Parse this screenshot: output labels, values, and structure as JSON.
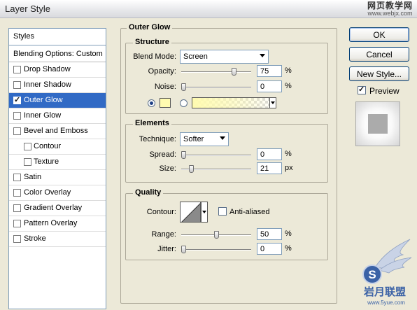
{
  "window": {
    "title": "Layer Style",
    "watermark_cn": "网页教学网",
    "watermark_url": "www.webjx.com"
  },
  "styles_list": {
    "header": "Styles",
    "blending_options": "Blending Options: Custom",
    "items": [
      {
        "label": "Drop Shadow",
        "checked": false,
        "sub": false,
        "selected": false
      },
      {
        "label": "Inner Shadow",
        "checked": false,
        "sub": false,
        "selected": false
      },
      {
        "label": "Outer Glow",
        "checked": true,
        "sub": false,
        "selected": true
      },
      {
        "label": "Inner Glow",
        "checked": false,
        "sub": false,
        "selected": false
      },
      {
        "label": "Bevel and Emboss",
        "checked": false,
        "sub": false,
        "selected": false
      },
      {
        "label": "Contour",
        "checked": false,
        "sub": true,
        "selected": false
      },
      {
        "label": "Texture",
        "checked": false,
        "sub": true,
        "selected": false
      },
      {
        "label": "Satin",
        "checked": false,
        "sub": false,
        "selected": false
      },
      {
        "label": "Color Overlay",
        "checked": false,
        "sub": false,
        "selected": false
      },
      {
        "label": "Gradient Overlay",
        "checked": false,
        "sub": false,
        "selected": false
      },
      {
        "label": "Pattern Overlay",
        "checked": false,
        "sub": false,
        "selected": false
      },
      {
        "label": "Stroke",
        "checked": false,
        "sub": false,
        "selected": false
      }
    ]
  },
  "outer_glow": {
    "title": "Outer Glow",
    "structure": {
      "title": "Structure",
      "blend_mode_label": "Blend Mode:",
      "blend_mode_value": "Screen",
      "opacity_label": "Opacity:",
      "opacity_value": "75",
      "opacity_unit": "%",
      "noise_label": "Noise:",
      "noise_value": "0",
      "noise_unit": "%",
      "glow_color": "#fffbb0",
      "color_mode": "solid"
    },
    "elements": {
      "title": "Elements",
      "technique_label": "Technique:",
      "technique_value": "Softer",
      "spread_label": "Spread:",
      "spread_value": "0",
      "spread_unit": "%",
      "size_label": "Size:",
      "size_value": "21",
      "size_unit": "px"
    },
    "quality": {
      "title": "Quality",
      "contour_label": "Contour:",
      "anti_aliased_label": "Anti-aliased",
      "anti_aliased": false,
      "range_label": "Range:",
      "range_value": "50",
      "range_unit": "%",
      "jitter_label": "Jitter:",
      "jitter_value": "0",
      "jitter_unit": "%"
    }
  },
  "buttons": {
    "ok": "OK",
    "cancel": "Cancel",
    "new_style": "New Style...",
    "preview_label": "Preview",
    "preview_checked": true
  },
  "watermark_bottom": {
    "letter": "S",
    "cn": "岩月联盟",
    "url": "www.5yue.com"
  }
}
